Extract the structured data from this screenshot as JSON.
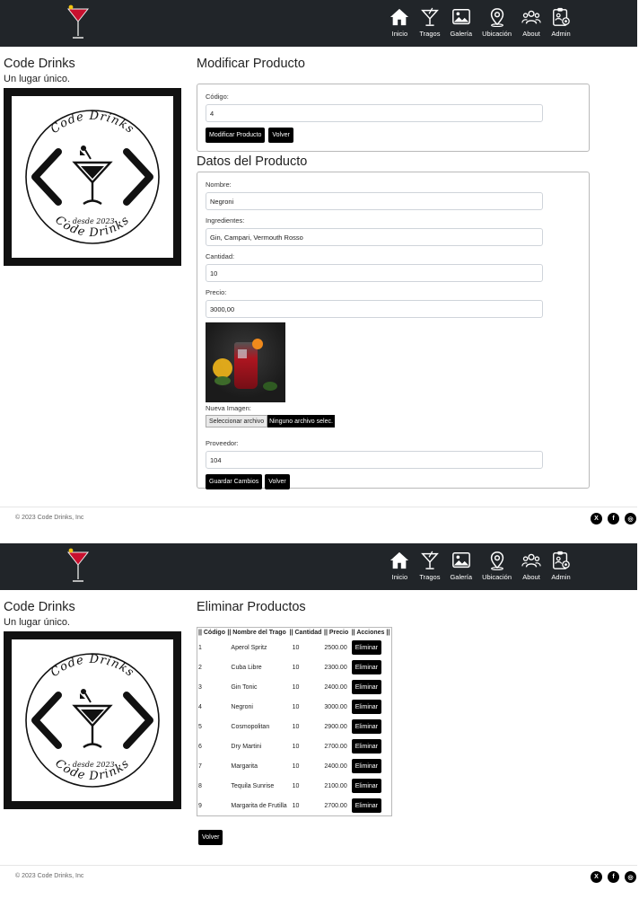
{
  "nav": {
    "items": [
      {
        "label": "Inicio",
        "icon": "home-icon"
      },
      {
        "label": "Tragos",
        "icon": "cocktail-icon"
      },
      {
        "label": "Galería",
        "icon": "gallery-icon"
      },
      {
        "label": "Ubicación",
        "icon": "location-pin-icon"
      },
      {
        "label": "About",
        "icon": "users-icon"
      },
      {
        "label": "Admin",
        "icon": "admin-clipboard-icon"
      }
    ]
  },
  "sidebar": {
    "title": "Code Drinks",
    "subtitle": "Un lugar único.",
    "logo_text_top": "Code Drinks",
    "logo_text_bottom": "Code Drinks",
    "logo_since": "- desde 2023-"
  },
  "modify": {
    "heading": "Modificar Producto",
    "code_label": "Código:",
    "code_value": "4",
    "modify_button": "Modificar Producto",
    "back_button": "Volver"
  },
  "details": {
    "heading": "Datos del Producto",
    "name_label": "Nombre:",
    "name_value": "Negroni",
    "ingredients_label": "Ingredientes:",
    "ingredients_value": "Gin, Campari, Vermouth Rosso",
    "quantity_label": "Cantidad:",
    "quantity_value": "10",
    "price_label": "Precio:",
    "price_value": "3000,00",
    "new_image_label": "Nueva Imagen:",
    "file_button": "Seleccionar archivo",
    "file_status": "Ninguno archivo selec.",
    "supplier_label": "Proveedor:",
    "supplier_value": "104",
    "save_button": "Guardar Cambios",
    "back_button": "Volver"
  },
  "footer": {
    "copyright": "© 2023 Code Drinks, Inc",
    "social": [
      {
        "icon": "x-twitter-icon",
        "glyph": "X"
      },
      {
        "icon": "facebook-icon",
        "glyph": "f"
      },
      {
        "icon": "instagram-icon",
        "glyph": "◎"
      }
    ]
  },
  "delete": {
    "heading": "Eliminar Productos",
    "columns": [
      "|| Código",
      "|| Nombre del Trago",
      "|| Cantidad",
      "|| Precio",
      "|| Acciones ||"
    ],
    "delete_label": "Eliminar",
    "back_button": "Volver",
    "rows": [
      {
        "code": "1",
        "name": "Aperol Spritz",
        "qty": "10",
        "price": "2500.00"
      },
      {
        "code": "2",
        "name": "Cuba Libre",
        "qty": "10",
        "price": "2300.00"
      },
      {
        "code": "3",
        "name": "Gin Tonic",
        "qty": "10",
        "price": "2400.00"
      },
      {
        "code": "4",
        "name": "Negroni",
        "qty": "10",
        "price": "3000.00"
      },
      {
        "code": "5",
        "name": "Cosmopolitan",
        "qty": "10",
        "price": "2900.00"
      },
      {
        "code": "6",
        "name": "Dry Martini",
        "qty": "10",
        "price": "2700.00"
      },
      {
        "code": "7",
        "name": "Margarita",
        "qty": "10",
        "price": "2400.00"
      },
      {
        "code": "8",
        "name": "Tequila Sunrise",
        "qty": "10",
        "price": "2100.00"
      },
      {
        "code": "9",
        "name": "Margarita de Frutilla",
        "qty": "10",
        "price": "2700.00"
      }
    ]
  }
}
